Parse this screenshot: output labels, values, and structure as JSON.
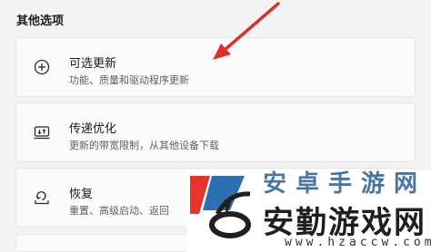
{
  "section": {
    "title": "其他选项"
  },
  "items": [
    {
      "label": "可选更新",
      "desc": "功能、质量和驱动程序更新",
      "icon": "plus-circle-icon"
    },
    {
      "label": "传递优化",
      "desc": "更新的带宽限制，从其他设备下载",
      "icon": "delivery-optimization-icon"
    },
    {
      "label": "恢复",
      "desc": "重置、高级启动、返回",
      "icon": "recovery-icon"
    }
  ],
  "annotation": {
    "arrow_color": "#d9302b"
  },
  "watermark": {
    "top_text": "安卓手游网",
    "main_text": "安勤游戏网",
    "url": "www.hzaccw.com",
    "colors": {
      "red": "#e8332a",
      "blue": "#2c6fb3",
      "dark": "#1f1f1f"
    }
  }
}
